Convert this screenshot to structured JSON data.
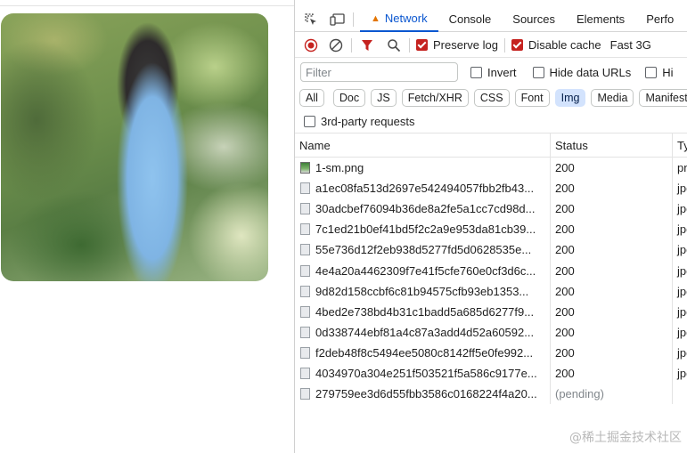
{
  "devtools": {
    "tabs": [
      "Network",
      "Console",
      "Sources",
      "Elements",
      "Perfo"
    ],
    "active_tab": "Network",
    "toolbar": {
      "preserve_log": "Preserve log",
      "disable_cache": "Disable cache",
      "throttling": "Fast 3G"
    },
    "filter": {
      "placeholder": "Filter",
      "invert": "Invert",
      "hide_data_urls": "Hide data URLs",
      "hide_ext": "Hi"
    },
    "type_filters": [
      "All",
      "Doc",
      "JS",
      "Fetch/XHR",
      "CSS",
      "Font",
      "Img",
      "Media",
      "Manifest"
    ],
    "active_type": "Img",
    "third_party": "3rd-party requests",
    "columns": {
      "name": "Name",
      "status": "Status",
      "type": "Typ"
    },
    "rows": [
      {
        "name": "1-sm.png",
        "status": "200",
        "type": "pn"
      },
      {
        "name": "a1ec08fa513d2697e542494057fbb2fb43...",
        "status": "200",
        "type": "jpe"
      },
      {
        "name": "30adcbef76094b36de8a2fe5a1cc7cd98d...",
        "status": "200",
        "type": "jpe"
      },
      {
        "name": "7c1ed21b0ef41bd5f2c2a9e953da81cb39...",
        "status": "200",
        "type": "jpe"
      },
      {
        "name": "55e736d12f2eb938d5277fd5d0628535e...",
        "status": "200",
        "type": "jpe"
      },
      {
        "name": "4e4a20a4462309f7e41f5cfe760e0cf3d6c...",
        "status": "200",
        "type": "jpe"
      },
      {
        "name": "9d82d158ccbf6c81b94575cfb93eb1353...",
        "status": "200",
        "type": "jpe"
      },
      {
        "name": "4bed2e738bd4b31c1badd5a685d6277f9...",
        "status": "200",
        "type": "jpe"
      },
      {
        "name": "0d338744ebf81a4c87a3add4d52a60592...",
        "status": "200",
        "type": "jpe"
      },
      {
        "name": "f2deb48f8c5494ee5080c8142ff5e0fe992...",
        "status": "200",
        "type": "jpe"
      },
      {
        "name": "4034970a304e251f503521f5a586c9177e...",
        "status": "200",
        "type": "jpe"
      },
      {
        "name": "279759ee3d6d55fbb3586c0168224f4a20...",
        "status": "(pending)",
        "type": ""
      }
    ]
  },
  "watermark": "@稀土掘金技术社区"
}
